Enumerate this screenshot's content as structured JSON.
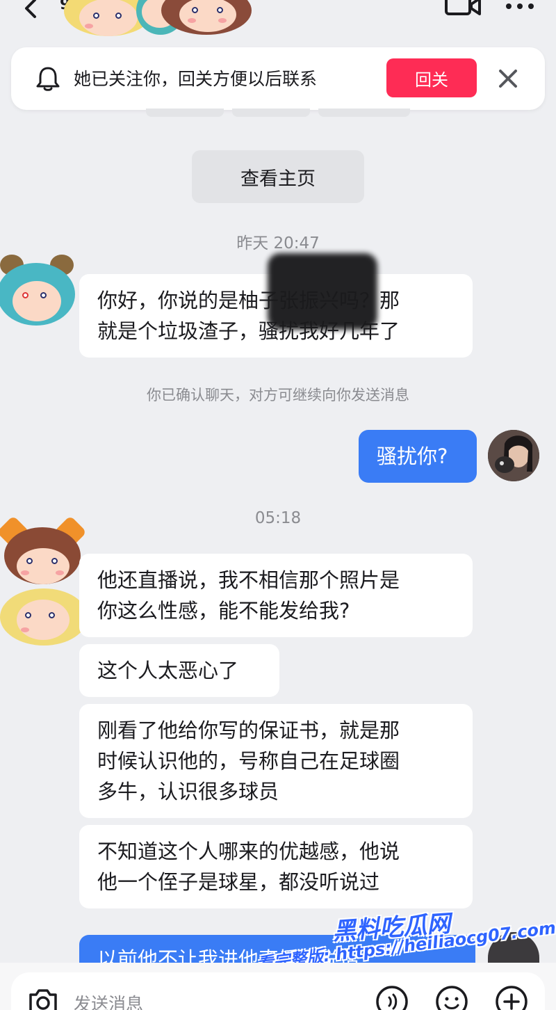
{
  "nav": {
    "count": "9"
  },
  "follow_banner": {
    "text": "她已关注你，回关方便以后联系",
    "button_label": "回关",
    "button_color": "#fe2c55"
  },
  "view_profile_label": "查看主页",
  "messages": {
    "timestamp_1": "昨天 20:47",
    "msg_1": "你好，你说的是柚子张振兴吗？那\n就是个垃圾渣子，骚扰我好几年了",
    "system_note": "你已确认聊天，对方可继续向你发送消息",
    "my_msg_1": "骚扰你?",
    "timestamp_2": "05:18",
    "msg_2": "他还直播说，我不相信那个照片是\n你这么性感，能不能发给我?",
    "msg_3": "这个人太恶心了",
    "msg_4": "刚看了他给你写的保证书，就是那\n时候认识他的，号称自己在足球圈\n多牛，认识很多球员",
    "msg_5": "不知道这个人哪来的优越感，他说\n他一个侄子是球星，都没听说过",
    "my_msg_partial": "以前他不让我进他直播间说话"
  },
  "input": {
    "placeholder": "发送消息"
  },
  "watermark": {
    "logo": "黑料吃瓜网",
    "line": "看完整版: https://heiliaocg07.com"
  },
  "colors": {
    "accent_blue": "#3a7cf5",
    "background": "#eeeff2"
  },
  "icons": [
    "back-icon",
    "video-icon",
    "more-icon",
    "bell-icon",
    "close-icon",
    "camera-icon",
    "voice-icon",
    "emoji-icon",
    "plus-icon"
  ]
}
